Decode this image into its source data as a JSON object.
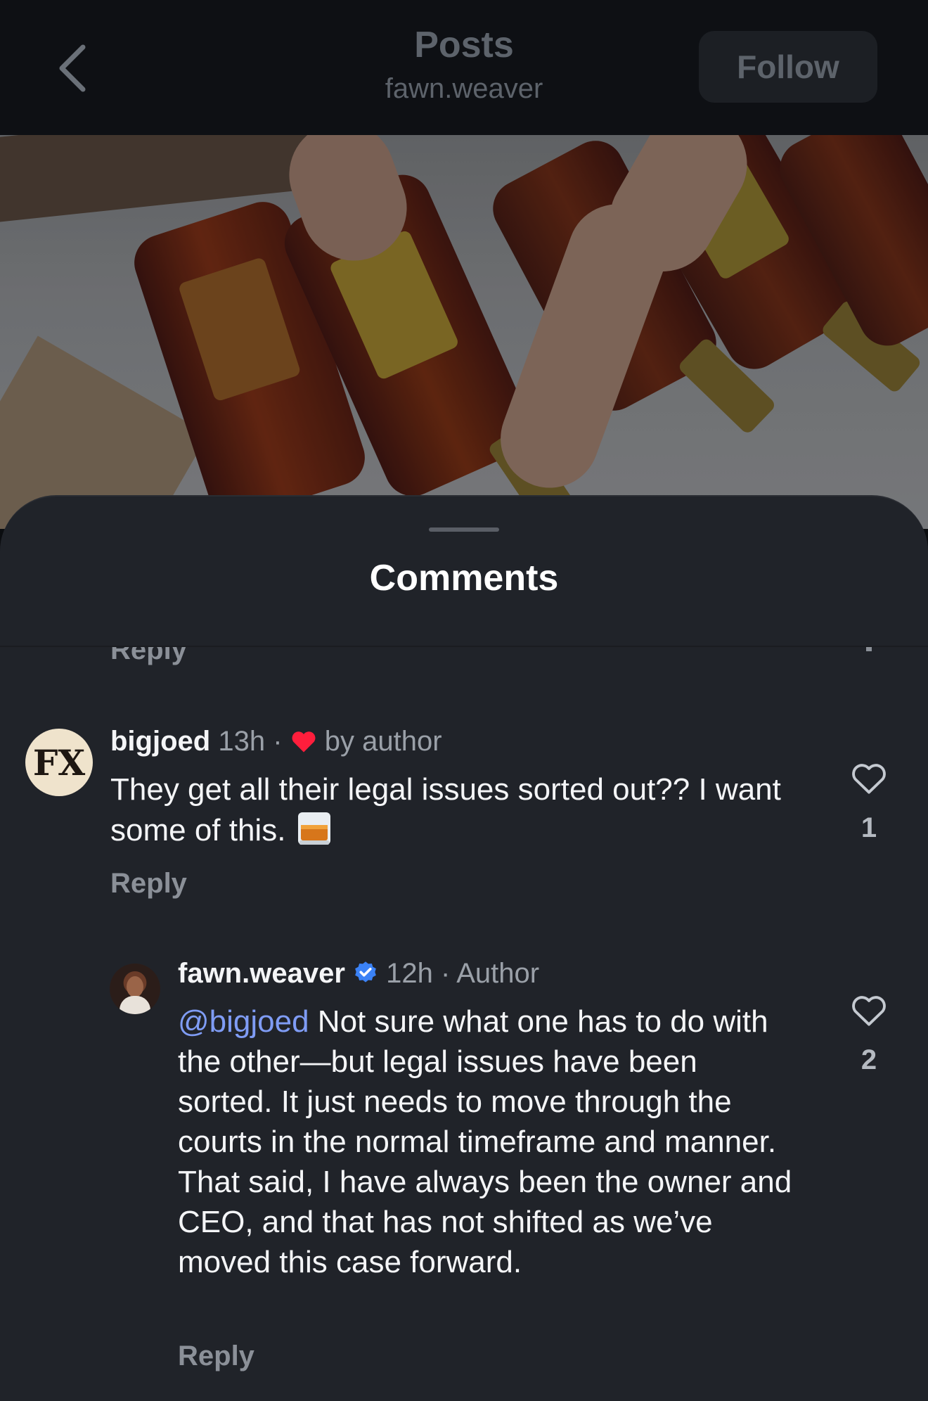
{
  "header": {
    "title": "Posts",
    "subtitle": "fawn.weaver",
    "follow_label": "Follow",
    "back_icon": "chevron-left-icon"
  },
  "photo": {
    "description_icon": "post-photo"
  },
  "sheet": {
    "title": "Comments",
    "partial_reply_label": "Reply"
  },
  "comments": [
    {
      "username": "bigjoed",
      "time": "13h",
      "separator": "·",
      "liked_by_author_label": "by author",
      "text": "They get all their legal issues sorted out?? I want some of this.",
      "emoji": "tumbler-glass-emoji",
      "reply_label": "Reply",
      "like_count": "1",
      "avatar_text": "FX"
    },
    {
      "username": "fawn.weaver",
      "time": "12h",
      "separator": "·",
      "author_label": "Author",
      "mention": "@bigjoed",
      "text": " Not sure what one has to do with the other—but legal issues have been sorted. It just needs to move through the courts in the normal timeframe and manner. That said, I have always been the owner and CEO, and that has not shifted as we’ve moved this case forward.",
      "reply_label": "Reply",
      "like_count": "2"
    }
  ],
  "colors": {
    "background": "#202329",
    "header": "#0e1014",
    "mention": "#7f9cf5",
    "verified": "#3b82f6",
    "heart": "#ff1e3c"
  }
}
